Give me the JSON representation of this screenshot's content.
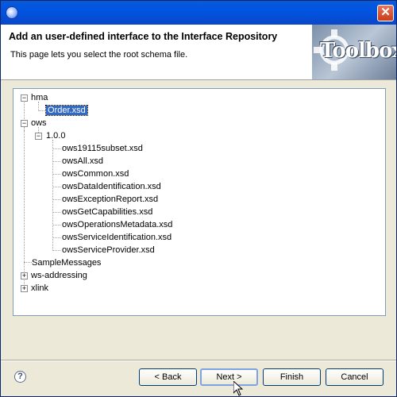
{
  "window": {
    "title": ""
  },
  "header": {
    "title": "Add an user-defined interface to the Interface Repository",
    "description": "This page lets you select the root schema file.",
    "banner_text": "Toolbox"
  },
  "tree": {
    "hma": {
      "label": "hma",
      "expanded": true,
      "children": {
        "order": "Order.xsd"
      }
    },
    "ows": {
      "label": "ows",
      "expanded": true,
      "v100": {
        "label": "1.0.0",
        "expanded": true,
        "files": [
          "ows19115subset.xsd",
          "owsAll.xsd",
          "owsCommon.xsd",
          "owsDataIdentification.xsd",
          "owsExceptionReport.xsd",
          "owsGetCapabilities.xsd",
          "owsOperationsMetadata.xsd",
          "owsServiceIdentification.xsd",
          "owsServiceProvider.xsd"
        ]
      }
    },
    "sample_messages": "SampleMessages",
    "ws_addressing": {
      "label": "ws-addressing",
      "expanded": false
    },
    "xlink": {
      "label": "xlink",
      "expanded": false
    },
    "selected": "Order.xsd"
  },
  "buttons": {
    "back": "< Back",
    "next": "Next >",
    "finish": "Finish",
    "cancel": "Cancel"
  },
  "icons": {
    "app": "eclipse-icon",
    "close": "close-icon",
    "help": "help-icon",
    "collapse": "minus",
    "expand": "plus"
  },
  "colors": {
    "titlebar": "#0054e3",
    "selection": "#316ac5",
    "dialog_bg": "#ece9d8"
  }
}
